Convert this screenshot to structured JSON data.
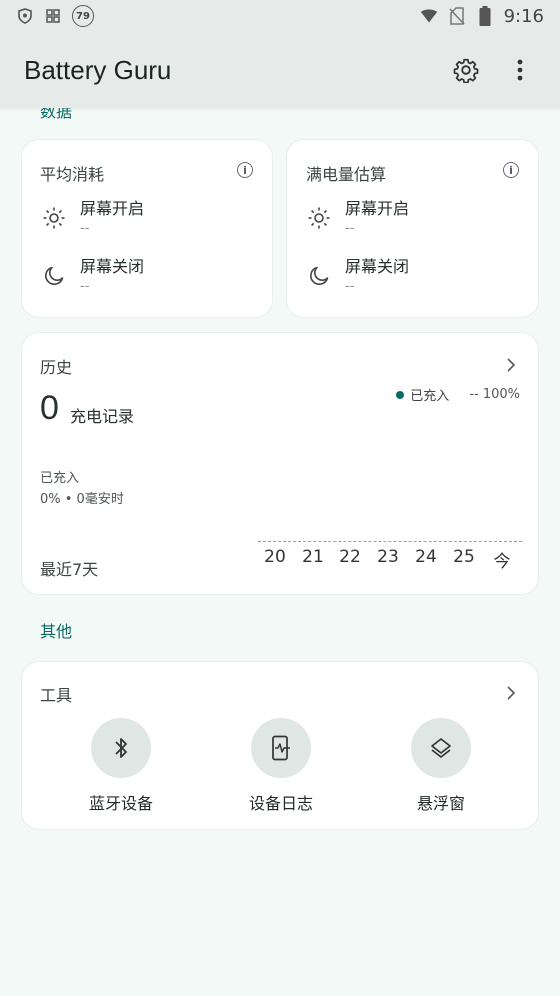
{
  "status_bar": {
    "notification_badge": "79",
    "time": "9:16"
  },
  "app_bar": {
    "title": "Battery Guru",
    "icons": [
      "settings-gear-icon",
      "more-vert-icon"
    ]
  },
  "scrolled_section_label": "数据",
  "avg_consumption": {
    "title": "平均消耗",
    "rows": [
      {
        "icon": "sun-icon",
        "label": "屏幕开启",
        "value": "--"
      },
      {
        "icon": "moon-icon",
        "label": "屏幕关闭",
        "value": "--"
      }
    ]
  },
  "full_charge_estimate": {
    "title": "满电量估算",
    "rows": [
      {
        "icon": "sun-icon",
        "label": "屏幕开启",
        "value": "--"
      },
      {
        "icon": "moon-icon",
        "label": "屏幕关闭",
        "value": "--"
      }
    ]
  },
  "history": {
    "title": "历史",
    "count": "0",
    "count_label": "充电记录",
    "legend_label": "已充入",
    "legend_value": "-- 100%",
    "charged_label": "已充入",
    "charged_value": "0% • 0毫安时",
    "period_label": "最近7天",
    "days": [
      "20",
      "21",
      "22",
      "23",
      "24",
      "25",
      "今"
    ],
    "accent_color": "#0b6a62"
  },
  "other_section_title": "其他",
  "tools": {
    "title": "工具",
    "items": [
      {
        "icon": "bluetooth-icon",
        "label": "蓝牙设备"
      },
      {
        "icon": "device-log-icon",
        "label": "设备日志"
      },
      {
        "icon": "layers-icon",
        "label": "悬浮窗"
      }
    ]
  }
}
